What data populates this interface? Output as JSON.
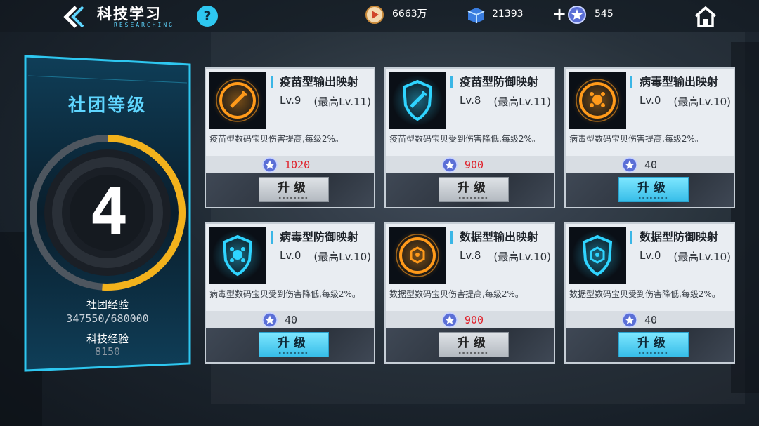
{
  "header": {
    "title": "科技学习",
    "subtitle": "RESEARCHING",
    "help": "?",
    "resources": [
      {
        "icon": "gold-medal-icon",
        "value": "6663万"
      },
      {
        "icon": "blue-cube-icon",
        "value": "21393"
      },
      {
        "icon": "star-coin-icon",
        "value": "545"
      }
    ],
    "plus": "+"
  },
  "club": {
    "title": "社团等级",
    "level": "4",
    "exp_label": "社团经验",
    "exp_value": "347550/680000",
    "exp_progress": 0.511,
    "tech_label": "科技经验",
    "tech_value": "8150"
  },
  "cards": [
    {
      "name": "疫苗型输出映射",
      "level": "Lv.9",
      "max": "(最高Lv.11)",
      "desc": "疫苗型数码宝贝伤害提高,每级2%。",
      "cost": "1020",
      "cost_color": "red",
      "button": "升级",
      "button_state": "grey",
      "icon": "vaccine-syringe-icon",
      "icon_color": "#ff9a1a"
    },
    {
      "name": "疫苗型防御映射",
      "level": "Lv.8",
      "max": "(最高Lv.11)",
      "desc": "疫苗型数码宝贝受到伤害降低,每级2%。",
      "cost": "900",
      "cost_color": "red",
      "button": "升级",
      "button_state": "grey",
      "icon": "vaccine-shield-icon",
      "icon_color": "#2fd4ff"
    },
    {
      "name": "病毒型输出映射",
      "level": "Lv.0",
      "max": "(最高Lv.10)",
      "desc": "病毒型数码宝贝伤害提高,每级2%。",
      "cost": "40",
      "cost_color": "dark",
      "button": "升级",
      "button_state": "blue",
      "icon": "virus-icon",
      "icon_color": "#ff9a1a"
    },
    {
      "name": "病毒型防御映射",
      "level": "Lv.0",
      "max": "(最高Lv.10)",
      "desc": "病毒型数码宝贝受到伤害降低,每级2%。",
      "cost": "40",
      "cost_color": "dark",
      "button": "升级",
      "button_state": "blue",
      "icon": "virus-shield-icon",
      "icon_color": "#2fd4ff"
    },
    {
      "name": "数据型输出映射",
      "level": "Lv.8",
      "max": "(最高Lv.10)",
      "desc": "数据型数码宝贝伤害提高,每级2%。",
      "cost": "900",
      "cost_color": "red",
      "button": "升级",
      "button_state": "grey",
      "icon": "data-hexagon-icon",
      "icon_color": "#ff9a1a"
    },
    {
      "name": "数据型防御映射",
      "level": "Lv.0",
      "max": "(最高Lv.10)",
      "desc": "数据型数码宝贝受到伤害降低,每级2%。",
      "cost": "40",
      "cost_color": "dark",
      "button": "升级",
      "button_state": "blue",
      "icon": "data-shield-icon",
      "icon_color": "#2fd4ff"
    }
  ]
}
